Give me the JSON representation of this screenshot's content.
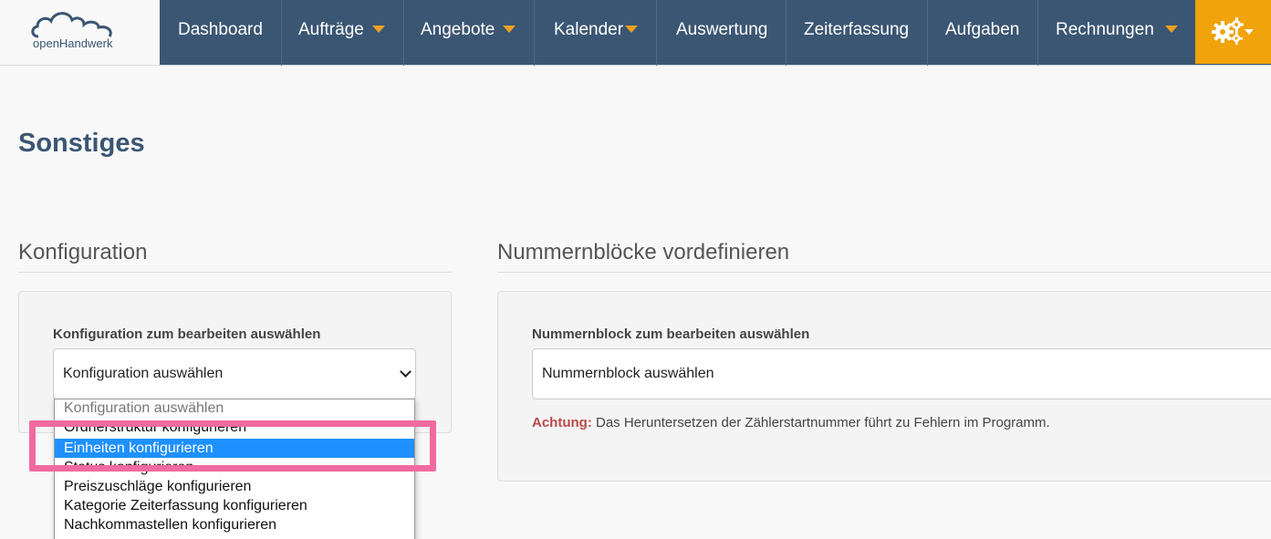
{
  "brand": {
    "name": "openHandwerk"
  },
  "nav": {
    "items": [
      {
        "label": "Dashboard",
        "caret": false
      },
      {
        "label": "Aufträge",
        "caret": true
      },
      {
        "label": "Angebote",
        "caret": true
      },
      {
        "label": "Kalender",
        "caret": true
      },
      {
        "label": "Auswertung",
        "caret": false
      },
      {
        "label": "Zeiterfassung",
        "caret": false
      },
      {
        "label": "Aufgaben",
        "caret": false
      },
      {
        "label": "Rechnungen",
        "caret": true
      }
    ],
    "settings_icon": "gears-icon"
  },
  "page": {
    "title": "Sonstiges"
  },
  "config": {
    "heading": "Konfiguration",
    "label": "Konfiguration zum bearbeiten auswählen",
    "select_value": "Konfiguration auswählen",
    "options": [
      "Konfiguration auswählen",
      "Ordnerstruktur konfigurieren",
      "Einheiten konfigurieren",
      "Status konfigurieren",
      "Preiszuschläge konfigurieren",
      "Kategorie Zeiterfassung konfigurieren",
      "Nachkommastellen konfigurieren"
    ],
    "highlighted_option": "Einheiten konfigurieren"
  },
  "numbers": {
    "heading": "Nummernblöcke vordefinieren",
    "label": "Nummernblock zum bearbeiten auswählen",
    "select_value": "Nummernblock auswählen",
    "warning_prefix": "Achtung:",
    "warning_text": " Das Heruntersetzen der Zählerstartnummer führt zu Fehlern im Programm."
  },
  "colors": {
    "nav_bg": "#3b5673",
    "accent": "#f0a30a",
    "highlight": "#f06aa0",
    "selected": "#1e90ff",
    "warning": "#b94a48"
  }
}
